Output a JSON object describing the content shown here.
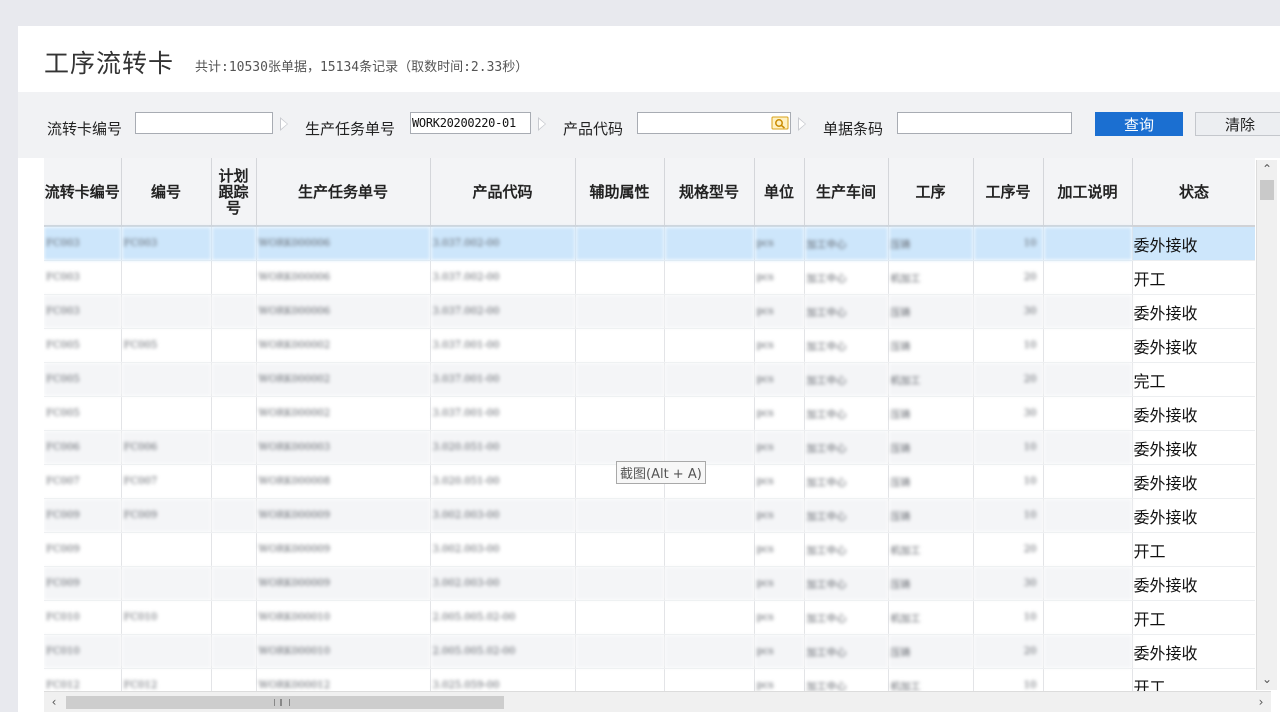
{
  "header": {
    "title": "工序流转卡",
    "summary": "共计:10530张单据，15134条记录（取数时间:2.33秒）"
  },
  "filters": {
    "card_no_label": "流转卡编号",
    "card_no_value": "",
    "task_no_label": "生产任务单号",
    "task_no_value": "WORK20200220-01",
    "product_code_label": "产品代码",
    "product_code_value": "",
    "barcode_label": "单据条码",
    "barcode_value": "",
    "query_button": "查询",
    "clear_button": "清除"
  },
  "columns": [
    "流转卡编号",
    "编号",
    "计划跟踪号",
    "生产任务单号",
    "产品代码",
    "辅助属性",
    "规格型号",
    "单位",
    "生产车间",
    "工序",
    "工序号",
    "加工说明",
    "状态"
  ],
  "rows": [
    {
      "c0": "FC003",
      "c1": "FC003",
      "c3": "WORK000006",
      "c4": "3.037.002-00",
      "c7": "pcs",
      "c8": "加工中心",
      "c9": "压铸",
      "c10": "10",
      "status": "委外接收"
    },
    {
      "c0": "FC003",
      "c1": "",
      "c3": "WORK000006",
      "c4": "3.037.002-00",
      "c7": "pcs",
      "c8": "加工中心",
      "c9": "机加工",
      "c10": "20",
      "status": "开工"
    },
    {
      "c0": "FC003",
      "c1": "",
      "c3": "WORK000006",
      "c4": "3.037.002-00",
      "c7": "pcs",
      "c8": "加工中心",
      "c9": "压铸",
      "c10": "30",
      "status": "委外接收"
    },
    {
      "c0": "FC005",
      "c1": "FC005",
      "c3": "WORK000002",
      "c4": "3.037.001-00",
      "c7": "pcs",
      "c8": "加工中心",
      "c9": "压铸",
      "c10": "10",
      "status": "委外接收"
    },
    {
      "c0": "FC005",
      "c1": "",
      "c3": "WORK000002",
      "c4": "3.037.001-00",
      "c7": "pcs",
      "c8": "加工中心",
      "c9": "机加工",
      "c10": "20",
      "status": "完工"
    },
    {
      "c0": "FC005",
      "c1": "",
      "c3": "WORK000002",
      "c4": "3.037.001-00",
      "c7": "pcs",
      "c8": "加工中心",
      "c9": "压铸",
      "c10": "30",
      "status": "委外接收"
    },
    {
      "c0": "FC006",
      "c1": "FC006",
      "c3": "WORK000003",
      "c4": "3.020.051-00",
      "c7": "pcs",
      "c8": "加工中心",
      "c9": "压铸",
      "c10": "10",
      "status": "委外接收"
    },
    {
      "c0": "FC007",
      "c1": "FC007",
      "c3": "WORK000008",
      "c4": "3.020.051-00",
      "c7": "pcs",
      "c8": "加工中心",
      "c9": "压铸",
      "c10": "10",
      "status": "委外接收"
    },
    {
      "c0": "FC009",
      "c1": "FC009",
      "c3": "WORK000009",
      "c4": "3.002.003-00",
      "c7": "pcs",
      "c8": "加工中心",
      "c9": "压铸",
      "c10": "10",
      "status": "委外接收"
    },
    {
      "c0": "FC009",
      "c1": "",
      "c3": "WORK000009",
      "c4": "3.002.003-00",
      "c7": "pcs",
      "c8": "加工中心",
      "c9": "机加工",
      "c10": "20",
      "status": "开工"
    },
    {
      "c0": "FC009",
      "c1": "",
      "c3": "WORK000009",
      "c4": "3.002.003-00",
      "c7": "pcs",
      "c8": "加工中心",
      "c9": "压铸",
      "c10": "30",
      "status": "委外接收"
    },
    {
      "c0": "FC010",
      "c1": "FC010",
      "c3": "WORK000010",
      "c4": "2.005.005.02-00",
      "c7": "pcs",
      "c8": "加工中心",
      "c9": "机加工",
      "c10": "10",
      "status": "开工"
    },
    {
      "c0": "FC010",
      "c1": "",
      "c3": "WORK000010",
      "c4": "2.005.005.02-00",
      "c7": "pcs",
      "c8": "加工中心",
      "c9": "压铸",
      "c10": "20",
      "status": "委外接收"
    },
    {
      "c0": "FC012",
      "c1": "FC012",
      "c3": "WORK000012",
      "c4": "3.025.059-00",
      "c7": "pcs",
      "c8": "加工中心",
      "c9": "机加工",
      "c10": "10",
      "status": "开工"
    }
  ],
  "tooltip": "截图(Alt + A)",
  "colors": {
    "accent": "#1b6fd1",
    "selected_row": "#cde6fb"
  }
}
